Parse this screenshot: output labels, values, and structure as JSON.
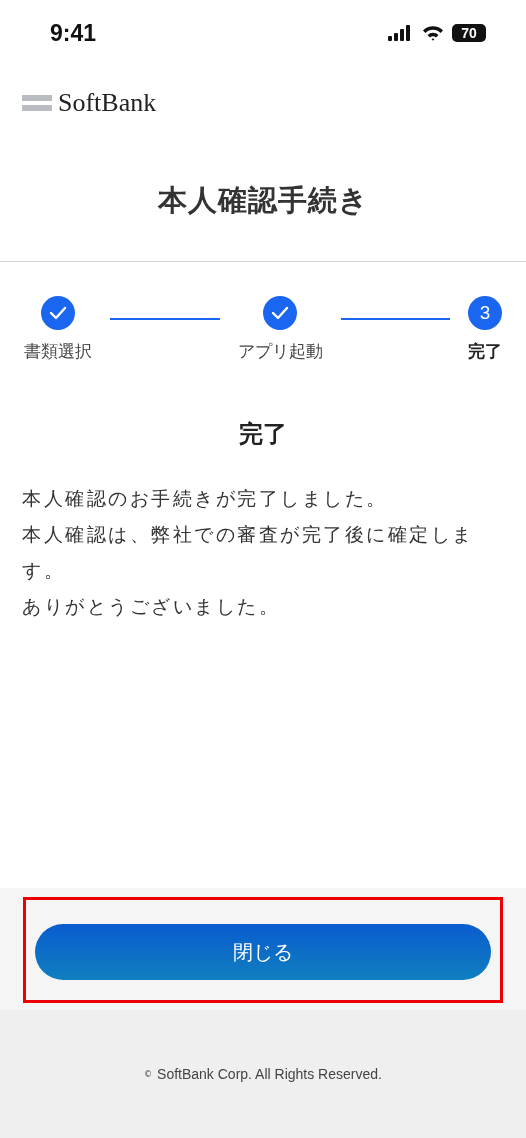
{
  "status_bar": {
    "time": "9:41",
    "battery": "70"
  },
  "header": {
    "brand": "SoftBank"
  },
  "title": "本人確認手続き",
  "steps": [
    {
      "label": "書類選択",
      "done": true,
      "selected": false
    },
    {
      "label": "アプリ起動",
      "done": true,
      "selected": false
    },
    {
      "label": "完了",
      "number": "3",
      "done": false,
      "selected": true
    }
  ],
  "heading": "完了",
  "message": [
    "本人確認のお手続きが完了しました。",
    "本人確認は、弊社での審査が完了後に確定します。",
    "ありがとうございました。"
  ],
  "close_button": {
    "label": "閉じる",
    "highlighted": true
  },
  "footer": {
    "copyright_mark": "©",
    "copyright": "SoftBank Corp. All Rights Reserved."
  }
}
